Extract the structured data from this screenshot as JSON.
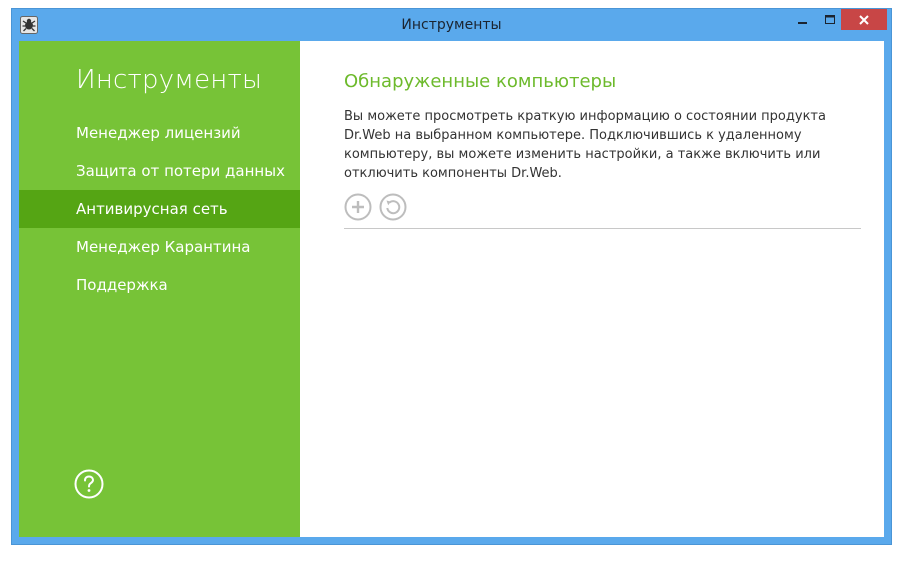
{
  "window": {
    "title": "Инструменты",
    "icons": {
      "app": "drweb-spider-icon",
      "minimize": "minimize-icon",
      "maximize": "maximize-icon",
      "close": "close-icon"
    }
  },
  "sidebar": {
    "title": "Инструменты",
    "items": [
      {
        "label": "Менеджер лицензий",
        "active": false
      },
      {
        "label": "Защита от потери данных",
        "active": false
      },
      {
        "label": "Антивирусная сеть",
        "active": true
      },
      {
        "label": "Менеджер Карантина",
        "active": false
      },
      {
        "label": "Поддержка",
        "active": false
      }
    ],
    "help_icon": "question-circle-icon"
  },
  "main": {
    "title": "Обнаруженные компьютеры",
    "description": "Вы можете просмотреть краткую информацию о состоянии продукта Dr.Web на выбранном компьютере. Подключившись к удаленному компьютеру, вы можете изменить настройки, а также включить или отключить компоненты Dr.Web.",
    "buttons": {
      "add_icon": "plus-circle-icon",
      "refresh_icon": "refresh-circle-icon"
    }
  },
  "colors": {
    "titlebar": "#5aa9ec",
    "sidebar": "#77c337",
    "sidebar_active": "#55a514",
    "accent_text": "#6dba2c",
    "close_button": "#c84646"
  }
}
